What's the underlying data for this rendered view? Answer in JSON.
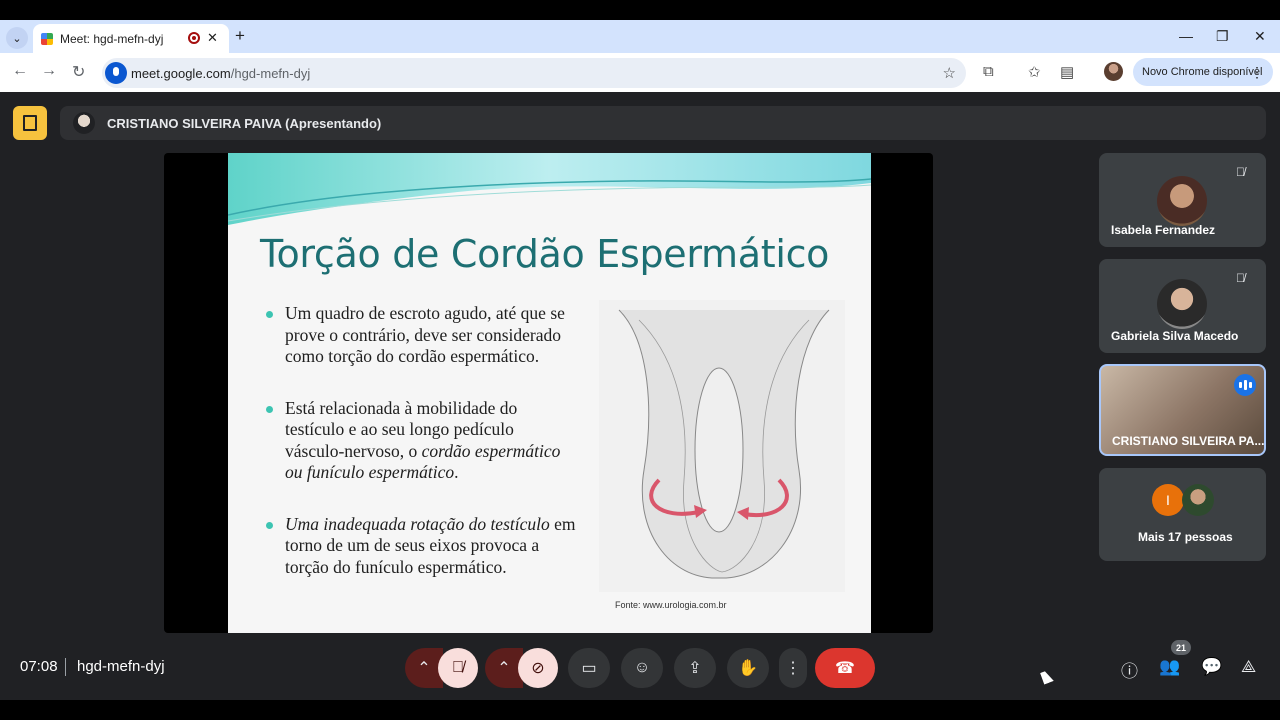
{
  "browser": {
    "tab_title": "Meet: hgd-mefn-dyj",
    "url_host": "meet.google.com",
    "url_path": "/hgd-mefn-dyj",
    "update_chip": "Novo Chrome disponível"
  },
  "meet": {
    "presenter_label": "CRISTIANO SILVEIRA PAIVA (Apresentando)",
    "slide": {
      "title": "Torção de Cordão Espermático",
      "bullet1": "Um quadro de escroto agudo, até que se prove o contrário, deve ser considerado como torção do cordão espermático.",
      "bullet2_plain": "Está relacionada à mobilidade do testículo e ao seu longo pedículo vásculo-nervoso, o ",
      "bullet2_italic": "cordão espermático ou funículo espermático",
      "bullet2_end": ".",
      "bullet3_italic": "Uma inadequada rotação do testículo",
      "bullet3_plain": " em torno de um de seus eixos provoca a torção do funículo espermático.",
      "source": "Fonte: www.urologia.com.br"
    },
    "participants": [
      {
        "name": "Isabela Fernandez",
        "muted": true
      },
      {
        "name": "Gabriela Silva Macedo",
        "muted": true
      },
      {
        "name": "CRISTIANO SILVEIRA PA...",
        "speaking": true
      },
      {
        "name": "Mais 17 pessoas",
        "initial": "I"
      }
    ],
    "clock": "07:08",
    "meeting_code": "hgd-mefn-dyj",
    "people_count": "21"
  },
  "colors": {
    "accent": "#1d6f73",
    "end_call": "#dc362e",
    "host_badge": "#f6c23e"
  }
}
